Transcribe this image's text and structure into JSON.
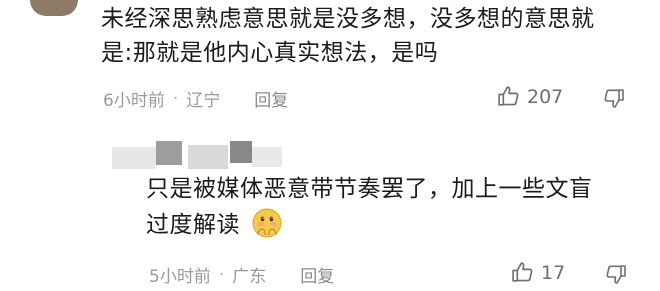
{
  "comments": [
    {
      "text_line1": "未经深思熟虑意思就是没多想，没多想的意思就",
      "text_line2": "是:那就是他内心真实想法，是吗",
      "time": "6小时前",
      "separator": "·",
      "location": "辽宁",
      "reply_label": "回复",
      "likes": "207",
      "like_icon": "thumbs-up-icon",
      "dislike_icon": "thumbs-down-icon"
    },
    {
      "text_line1": "只是被媒体恶意带节奏罢了，加上一些文盲",
      "text_line2": "过度解读",
      "emoji": "blushing-hands-emoji",
      "time": "5小时前",
      "separator": "·",
      "location": "广东",
      "reply_label": "回复",
      "likes": "17",
      "like_icon": "thumbs-up-icon",
      "dislike_icon": "thumbs-down-icon"
    }
  ],
  "colors": {
    "text": "#1b1b1b",
    "meta": "#9a9a9a",
    "icon": "#6f6f6f",
    "emoji": "#f6c94a"
  }
}
